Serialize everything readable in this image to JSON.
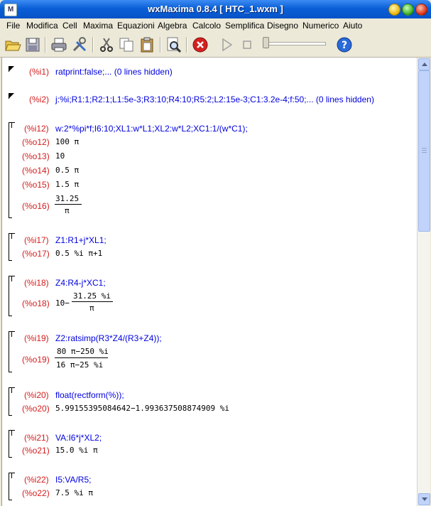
{
  "window": {
    "title": "wxMaxima 0.8.4  [ HTC_1.wxm ]"
  },
  "menu": [
    "File",
    "Modifica",
    "Cell",
    "Maxima",
    "Equazioni",
    "Algebra",
    "Calcolo",
    "Semplifica",
    "Disegno",
    "Numerico",
    "Aiuto"
  ],
  "toolbar_icons": [
    "open-icon",
    "save-icon",
    "print-icon",
    "preferences-icon",
    "cut-icon",
    "copy-icon",
    "paste-icon",
    "find-icon",
    "interrupt-icon",
    "play-icon",
    "stop-icon",
    "animation-slider",
    "help-icon"
  ],
  "cells": {
    "c1": {
      "label": "(%i1)",
      "code": "ratprint:false;... (0 lines hidden)"
    },
    "c2": {
      "label": "(%i2)",
      "code": "j:%i;R1:1;R2:1;L1:5e-3;R3:10;R4:10;R5:2;L2:15e-3;C1:3.2e-4;f:50;... (0 lines hidden)"
    },
    "c3": {
      "label": "(%i12)",
      "code": "w:2*%pi*f;I6:10;XL1:w*L1;XL2:w*L2;XC1:1/(w*C1);",
      "outputs": [
        {
          "label": "(%o12)",
          "value": "100 π"
        },
        {
          "label": "(%o13)",
          "value": "10"
        },
        {
          "label": "(%o14)",
          "value": "0.5 π"
        },
        {
          "label": "(%o15)",
          "value": "1.5 π"
        },
        {
          "label": "(%o16)",
          "num": "31.25",
          "den": "π"
        }
      ]
    },
    "c4": {
      "label": "(%i17)",
      "code": "Z1:R1+j*XL1;",
      "out_label": "(%o17)",
      "out": "0.5 %i π+1"
    },
    "c5": {
      "label": "(%i18)",
      "code": "Z4:R4-j*XC1;",
      "out_label": "(%o18)",
      "prefix": "10−",
      "num": "31.25 %i",
      "den": "π"
    },
    "c6": {
      "label": "(%i19)",
      "code": "Z2:ratsimp(R3*Z4/(R3+Z4));",
      "out_label": "(%o19)",
      "num": "80 π−250 %i",
      "den": "16 π−25 %i"
    },
    "c7": {
      "label": "(%i20)",
      "code": "float(rectform(%));",
      "out_label": "(%o20)",
      "out": "5.99155395084642−1.993637508874909 %i"
    },
    "c8": {
      "label": "(%i21)",
      "code": "VA:I6*j*XL2;",
      "out_label": "(%o21)",
      "out": "15.0 %i π"
    },
    "c9": {
      "label": "(%i22)",
      "code": "I5:VA/R5;",
      "out_label": "(%o22)",
      "out": "7.5 %i π"
    }
  }
}
